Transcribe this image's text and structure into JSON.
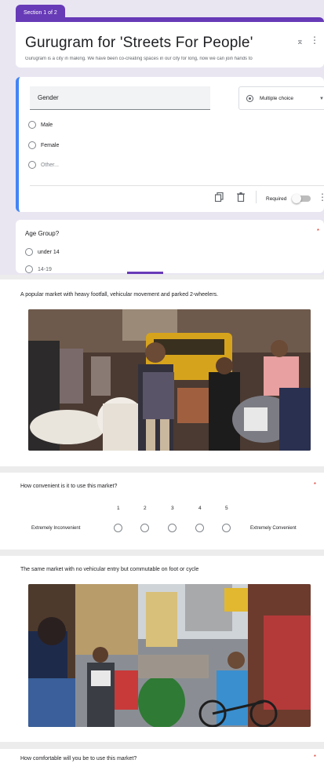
{
  "section_label": "Section 1 of 2",
  "form": {
    "title": "Gurugram for 'Streets For People'",
    "description": "Gurugram is a city in making. We have been co-creating spaces in our city for long, now we can join hands to"
  },
  "gender_question": {
    "title": "Gender",
    "type_label": "Multiple choice",
    "options": [
      "Male",
      "Female",
      "Other..."
    ],
    "required_label": "Required"
  },
  "age_question": {
    "title": "Age Group?",
    "required_mark": "*",
    "options": [
      "under 14",
      "14-19"
    ]
  },
  "market_1": {
    "caption": "A popular market with heavy footfall, vehicular movement and parked 2-wheelers."
  },
  "convenience_question": {
    "title": "How convenient is it to use this market?",
    "required_mark": "*",
    "scale": [
      "1",
      "2",
      "3",
      "4",
      "5"
    ],
    "low_label": "Extremely Inconvenient",
    "high_label": "Extremely Convenient"
  },
  "market_2": {
    "caption": "The same market with no vehicular entry but commutable on foot or cycle"
  },
  "comfort_question": {
    "title": "How comfortable will you be to use this market?",
    "required_mark": "*"
  },
  "colors": {
    "accent": "#673ab7",
    "focus": "#4285f4",
    "background": "#e9e6f2"
  }
}
